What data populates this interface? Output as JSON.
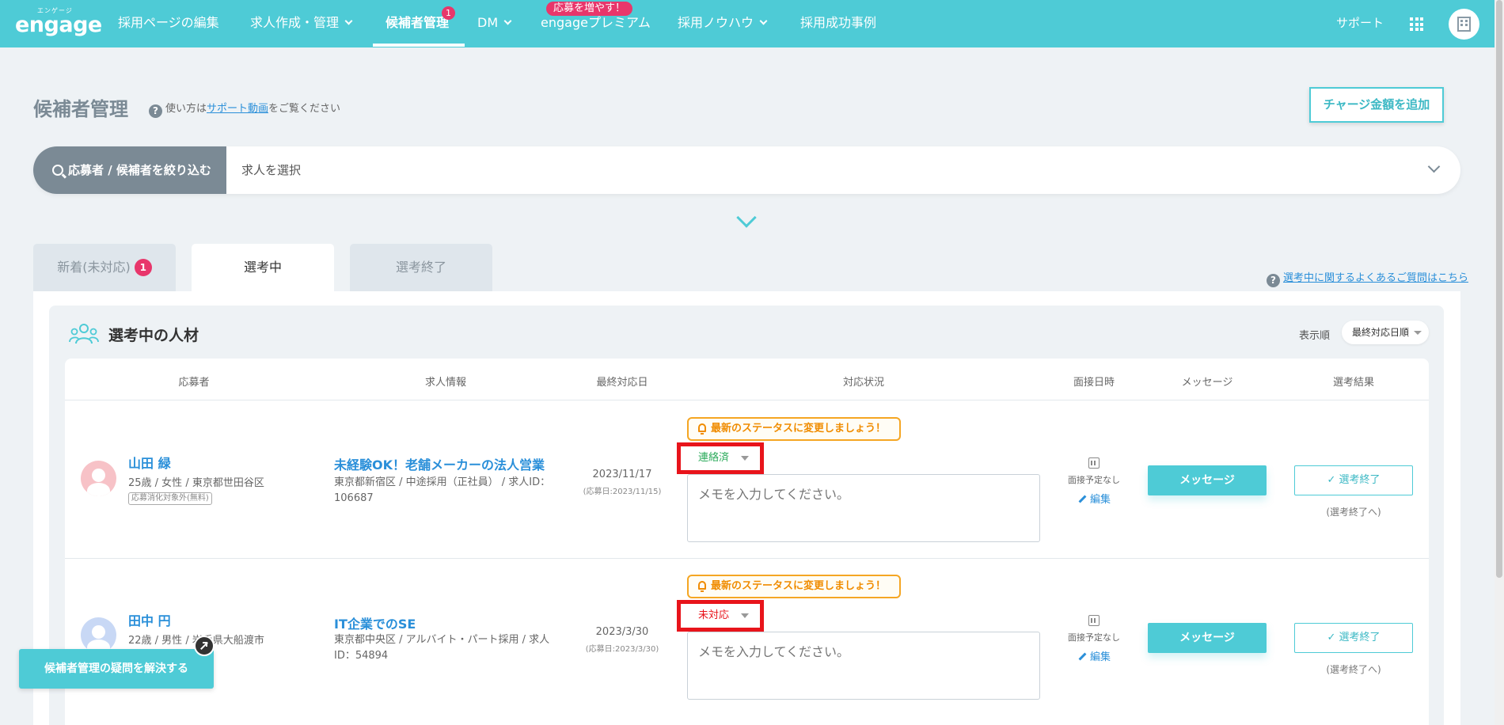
{
  "nav": {
    "logo_ruby": "エンゲージ",
    "logo": "engage",
    "items": [
      {
        "label": "採用ページの編集"
      },
      {
        "label": "求人作成・管理"
      },
      {
        "label": "候補者管理",
        "badge": "1"
      },
      {
        "label": "DM"
      },
      {
        "label": "engageプレミアム",
        "promo": "応募を増やす！"
      },
      {
        "label": "採用ノウハウ"
      },
      {
        "label": "採用成功事例"
      }
    ],
    "support": "サポート"
  },
  "page": {
    "title": "候補者管理",
    "help_prefix": "使い方は",
    "help_link": "サポート動画",
    "help_suffix": "をご覧ください",
    "charge_button": "チャージ金額を追加"
  },
  "filter": {
    "button": "応募者 / 候補者を絞り込む",
    "select_placeholder": "求人を選択"
  },
  "tabs": [
    {
      "label": "新着(未対応)",
      "badge": "1"
    },
    {
      "label": "選考中"
    },
    {
      "label": "選考終了"
    }
  ],
  "faq_link": "選考中に関するよくあるご質問はこちら",
  "section": {
    "title": "選考中の人材",
    "sort_label": "表示順",
    "sort_value": "最終対応日順"
  },
  "table": {
    "headers": [
      "応募者",
      "求人情報",
      "最終対応日",
      "対応状況",
      "面接日時",
      "メッセージ",
      "選考結果"
    ],
    "rows": [
      {
        "name": "山田 緑",
        "meta": "25歳  /  女性  /  東京都世田谷区",
        "tag": "応募消化対象外(無料)",
        "job_title": "未経験OK！老舗メーカーの法人営業",
        "job_meta": "東京都新宿区  /  中途採用（正社員）  /  求人ID：106687",
        "date": "2023/11/17",
        "applied": "(応募日:2023/11/15)",
        "alert": "最新のステータスに変更しましょう！",
        "status": "連絡済",
        "memo_placeholder": "メモを入力してください。",
        "interview": "面接予定なし",
        "edit": "編集",
        "message_btn": "メッセージ",
        "finish_btn": "✓ 選考終了",
        "finish_sub": "(選考終了へ)"
      },
      {
        "name": "田中 円",
        "meta": "22歳  /  男性  /  岩手県大船渡市",
        "job_title": "IT企業でのSE",
        "job_meta": "東京都中央区  /  アルバイト・パート採用  /  求人ID：54894",
        "date": "2023/3/30",
        "applied": "(応募日:2023/3/30)",
        "alert": "最新のステータスに変更しましょう！",
        "status": "未対応",
        "memo_placeholder": "メモを入力してください。",
        "interview": "面接予定なし",
        "edit": "編集",
        "message_btn": "メッセージ",
        "finish_btn": "✓ 選考終了",
        "finish_sub": "(選考終了へ)"
      }
    ]
  },
  "float_help": "候補者管理の疑問を解決する",
  "colors": {
    "brand": "#4ecbd6",
    "badge": "#e8366b",
    "status_green": "#2aaa5a",
    "status_red": "#e8141b",
    "highlight_box": "#e8141b",
    "alert": "#f5a623"
  }
}
